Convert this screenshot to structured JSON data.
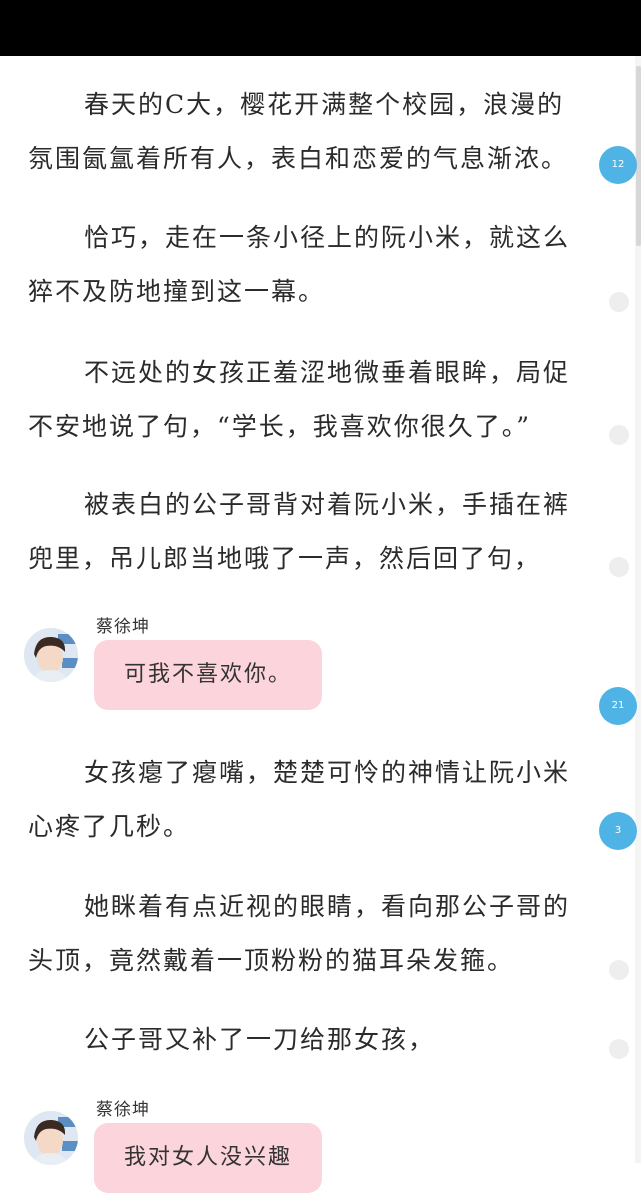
{
  "paragraphs": [
    "春天的C大，樱花开满整个校园，浪漫的氛围氤氲着所有人，表白和恋爱的气息渐浓。",
    "恰巧，走在一条小径上的阮小米，就这么猝不及防地撞到这一幕。",
    "不远处的女孩正羞涩地微垂着眼眸，局促不安地说了句，“学长，我喜欢你很久了。”",
    "被表白的公子哥背对着阮小米，手插在裤兜里，吊儿郎当地哦了一声，然后回了句，",
    "女孩瘪了瘪嘴，楚楚可怜的神情让阮小米心疼了几秒。",
    "她眯着有点近视的眼睛，看向那公子哥的头顶，竟然戴着一顶粉粉的猫耳朵发箍。",
    "公子哥又补了一刀给那女孩，"
  ],
  "chat_messages": [
    {
      "speaker": "蔡徐坤",
      "text": "可我不喜欢你。"
    },
    {
      "speaker": "蔡徐坤",
      "text": "我对女人没兴趣"
    }
  ],
  "comment_badges": [
    "12",
    "21",
    "3"
  ],
  "colors": {
    "status_bar": "#000000",
    "bubble": "#fbd4dc",
    "badge": "#4fb3e6",
    "empty_dot": "#eeeeee"
  }
}
